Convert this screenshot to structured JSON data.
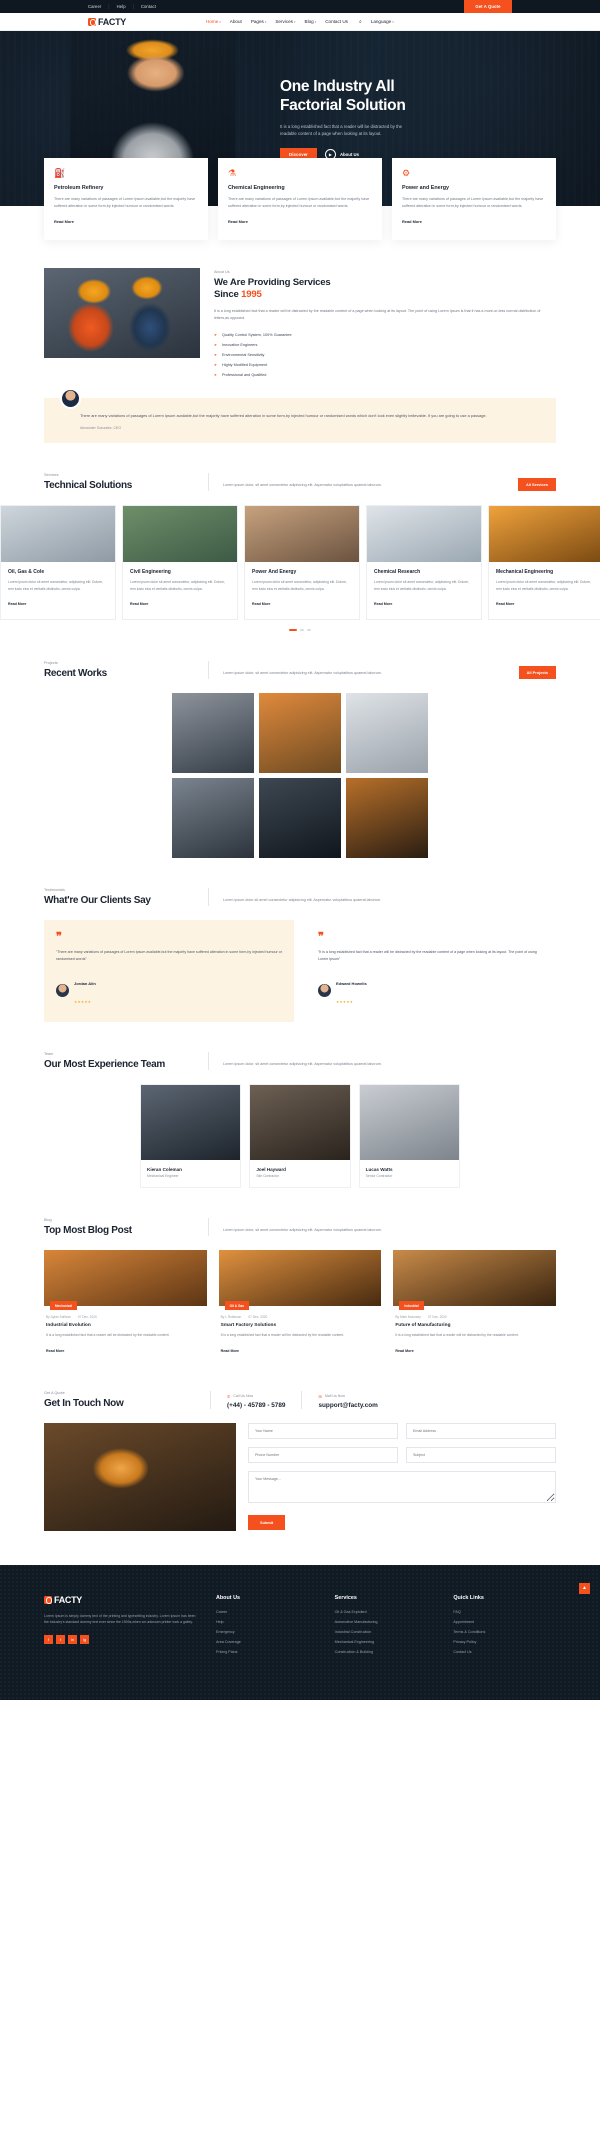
{
  "topbar": {
    "links": [
      "Career",
      "Help",
      "Contact"
    ],
    "quote_button": "Get A Quote"
  },
  "nav": {
    "brand": "FACTY",
    "items": [
      {
        "label": "Home",
        "caret": true,
        "active": true
      },
      {
        "label": "About",
        "caret": false,
        "active": false
      },
      {
        "label": "Pages",
        "caret": true,
        "active": false
      },
      {
        "label": "Services",
        "caret": true,
        "active": false
      },
      {
        "label": "Blog",
        "caret": true,
        "active": false
      },
      {
        "label": "Contact Us",
        "caret": false,
        "active": false
      }
    ],
    "search_icon": "search-icon",
    "language": "Language"
  },
  "hero": {
    "title_line1": "One Industry All",
    "title_line2": "Factorial Solution",
    "subtitle": "It is a long established fact that a reader will be distracted by the readable content of a page when looking at its layout.",
    "primary_button": "Discover",
    "play_label": "About Us"
  },
  "features": [
    {
      "icon": "oil-derrick-icon",
      "glyph": "⛽",
      "title": "Petroleum Refinery",
      "text": "There are many variations of passages of Lorem Ipsum available,but the majority have suffered alteration in some form,by injected humour or randomised words.",
      "more": "Read More"
    },
    {
      "icon": "flask-icon",
      "glyph": "⚗",
      "title": "Chemical Engineering",
      "text": "There are many variations of passages of Lorem Ipsum available,but the majority have suffered alteration in some form,by injected humour or randomised words.",
      "more": "Read More"
    },
    {
      "icon": "power-tower-icon",
      "glyph": "⚙",
      "title": "Power and Energy",
      "text": "There are many variations of passages of Lorem Ipsum available,but the majority have suffered alteration in some form,by injected humour or randomised words.",
      "more": "Read More"
    }
  ],
  "about": {
    "kicker": "About Us",
    "title_a": "We Are Providing Services",
    "title_b": "Since ",
    "title_hl": "1995",
    "text": "It is a long established fact that a reader will be distracted by the readable content of a page when looking at its layout. The point of using Lorem Ipsum is that it has a more-or-less normal distribution of letters,as opposed.",
    "list": [
      "Quality Control System, 100% Guarantee",
      "Innovative Engineers",
      "Environmental Sensitivity",
      "Highly Modified Equipment",
      "Professional and Qualified"
    ]
  },
  "quote": {
    "text": "There are many variations of passages of Lorem Ipsum available,but the majority have suffered alteration in some form,by injected humour or randomised words which don't look even slightly believable. If you are going to use a passage.",
    "author": "Alexander Gonzalez, CEO"
  },
  "services_section": {
    "kicker": "Services",
    "title": "Technical Solutions",
    "desc": "Lorem ipsum dolor, sit amet consectetur adipisicing elit. Aspernatur voluptatibus quaerat laborum.",
    "button": "All Services",
    "cards": [
      {
        "title": "Oil, Gas & Cole",
        "text": "Lorem ipsum dolor sit amet consectetur, adipisicing elit. Dolore, rem iusto eius et veritatis distinctio, omnis culpa.",
        "more": "Read More"
      },
      {
        "title": "Civil Engineering",
        "text": "Lorem ipsum dolor sit amet consectetur, adipisicing elit. Dolore, rem iusto eius et veritatis distinctio, omnis culpa.",
        "more": "Read More"
      },
      {
        "title": "Power And Energy",
        "text": "Lorem ipsum dolor sit amet consectetur, adipisicing elit. Dolore, rem iusto eius et veritatis distinctio, omnis culpa.",
        "more": "Read More"
      },
      {
        "title": "Chemical Research",
        "text": "Lorem ipsum dolor sit amet consectetur, adipisicing elit. Dolore, rem iusto eius et veritatis distinctio, omnis culpa.",
        "more": "Read More"
      },
      {
        "title": "Mechanical Engineering",
        "text": "Lorem ipsum dolor sit amet consectetur, adipisicing elit. Dolore, rem iusto eius et veritatis distinctio, omnis culpa.",
        "more": "Read More"
      }
    ]
  },
  "projects_section": {
    "kicker": "Projects",
    "title": "Recent Works",
    "desc": "Lorem ipsum dolor, sit amet consectetur adipisicing elit. Aspernatur voluptatibus quaerat laborum.",
    "button": "All Projects"
  },
  "testimonials_section": {
    "kicker": "Testimonials",
    "title": "What're Our Clients Say",
    "desc": "Lorem ipsum dolor sit amet consectetur adipisicing elit. Aspernatur voluptatibus quaerat laborum.",
    "items": [
      {
        "mark": "❞",
        "text": "\"There are many variations of passages of Lorem Ipsum available,but the majority have suffered alteration in some form,by injected humour or randomised words\"",
        "name": "Jordan Alin",
        "stars": "★★★★★"
      },
      {
        "mark": "❞",
        "text": "\"It is a long established fact that a reader will be distracted by the readable content of a page when looking at its layout. The point of using Lorem Ipsum\"",
        "name": "Edward Howells",
        "stars": "★★★★★"
      }
    ]
  },
  "team_section": {
    "kicker": "Team",
    "title": "Our Most Experience Team",
    "desc": "Lorem ipsum dolor, sit amet consectetur adipisicing elit. Aspernatur voluptatibus quaerat laborum.",
    "members": [
      {
        "name": "Kieran Coleman",
        "role": "Mechanical Engineer"
      },
      {
        "name": "Joel Hayward",
        "role": "Site Contractor"
      },
      {
        "name": "Lucas Watts",
        "role": "Senior Contractor"
      }
    ]
  },
  "blog_section": {
    "kicker": "Blog",
    "title": "Top Most Blog Post",
    "desc": "Lorem ipsum dolor, sit amet consectetur adipisicing elit. Aspernatur voluptatibus quaerat laborum.",
    "posts": [
      {
        "tag": "Mechanical",
        "author": "By Dylan Sullivan",
        "date": "07 Dec, 2020",
        "title": "Industrial Evolution",
        "text": "It is a long established fact that a reader will be distracted by the readable content.",
        "more": "Read More"
      },
      {
        "tag": "Oil & Gas",
        "author": "By L Robinson",
        "date": "07 Dec, 2020",
        "title": "Smart Factory Solutions",
        "text": "It is a long established fact that a reader will be distracted by the readable content.",
        "more": "Read More"
      },
      {
        "tag": "Industrial",
        "author": "By Mark Mounsey",
        "date": "07 Dec, 2020",
        "title": "Future of Manufacturing",
        "text": "It is a long established fact that a reader will be distracted by the readable content.",
        "more": "Read More"
      }
    ]
  },
  "contact": {
    "kicker": "Get A Quote",
    "title": "Get In Touch Now",
    "phone_label": "Call Us Now",
    "phone_icon": "phone-icon",
    "phone_value": "(+44) - 45789 - 5789",
    "mail_label": "Mail Us Now",
    "mail_icon": "mail-icon",
    "mail_value": "support@facty.com",
    "fields": {
      "name_placeholder": "Your Name",
      "email_placeholder": "Email Address",
      "phone_placeholder": "Phone Number",
      "subject_placeholder": "Subject",
      "message_placeholder": "Your Message..."
    },
    "submit": "Submit"
  },
  "footer": {
    "brand": "FACTY",
    "about_text": "Lorem Ipsum is simply dummy text of the printing and typesetting industry. Lorem Ipsum has been the industry's standard dummy text ever since the 1500s,when an unknown printer took a galley.",
    "socials": [
      "f",
      "t",
      "in",
      "ig"
    ],
    "columns": [
      {
        "heading": "About Us",
        "links": [
          "Career",
          "Help",
          "Emergency",
          "Area Coverage",
          "Pricing Plans"
        ]
      },
      {
        "heading": "Services",
        "links": [
          "Oil & Gas Exploited",
          "Automotive Manufacturing",
          "Industrial Construction",
          "Mechanical Engineering",
          "Construction & Building"
        ]
      },
      {
        "heading": "Quick Links",
        "links": [
          "FAQ",
          "Appointment",
          "Terms & Conditions",
          "Privacy Policy",
          "Contact Us"
        ]
      }
    ],
    "scroll_top_icon": "arrow-up-icon"
  }
}
